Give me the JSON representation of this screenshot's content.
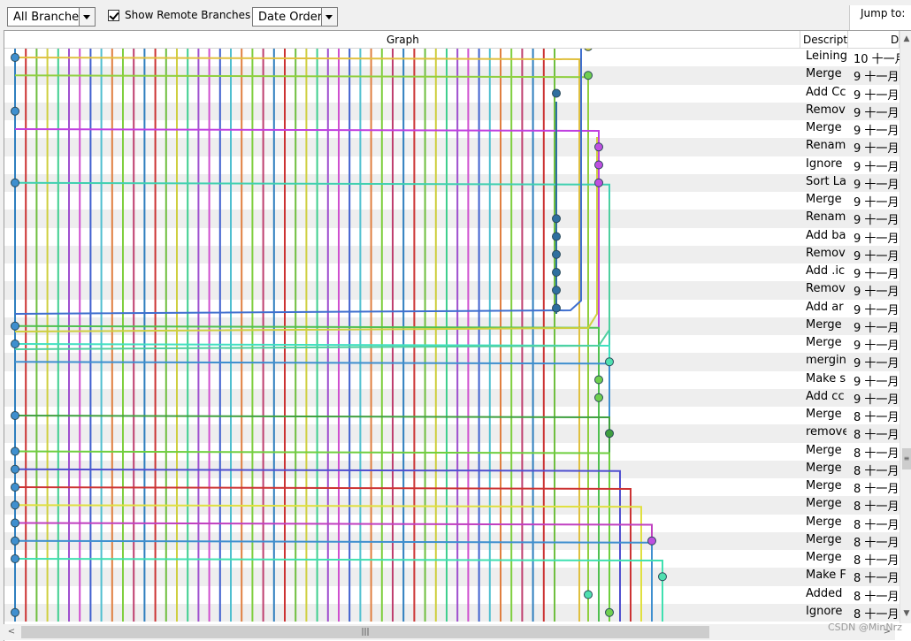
{
  "toolbar": {
    "branch_select": "All Branches",
    "show_remote_label": "Show Remote Branches",
    "show_remote_checked": true,
    "order_select": "Date Order",
    "jump_label": "Jump to:"
  },
  "columns": {
    "graph": "Graph",
    "description": "Descript",
    "date": "D"
  },
  "rows": [
    {
      "desc": "Leining",
      "date": "10 十一月"
    },
    {
      "desc": "Merge",
      "date": "9 十一月"
    },
    {
      "desc": "Add Cc",
      "date": "9 十一月"
    },
    {
      "desc": "Remov",
      "date": "9 十一月"
    },
    {
      "desc": "Merge",
      "date": "9 十一月"
    },
    {
      "desc": "Renam",
      "date": "9 十一月"
    },
    {
      "desc": "Ignore",
      "date": "9 十一月"
    },
    {
      "desc": "Sort La",
      "date": "9 十一月"
    },
    {
      "desc": "Merge",
      "date": "9 十一月"
    },
    {
      "desc": "Renam",
      "date": "9 十一月"
    },
    {
      "desc": "Add ba",
      "date": "9 十一月"
    },
    {
      "desc": "Remov",
      "date": "9 十一月"
    },
    {
      "desc": "Add .ic",
      "date": "9 十一月"
    },
    {
      "desc": "Remov",
      "date": "9 十一月"
    },
    {
      "desc": "Add ar",
      "date": "9 十一月"
    },
    {
      "desc": "Merge",
      "date": "9 十一月"
    },
    {
      "desc": "Merge",
      "date": "9 十一月"
    },
    {
      "desc": "mergin",
      "date": "9 十一月"
    },
    {
      "desc": "Make s",
      "date": "9 十一月"
    },
    {
      "desc": "Add cc",
      "date": "9 十一月"
    },
    {
      "desc": "Merge",
      "date": "8 十一月"
    },
    {
      "desc": "remove",
      "date": "8 十一月"
    },
    {
      "desc": "Merge",
      "date": "8 十一月"
    },
    {
      "desc": "Merge",
      "date": "8 十一月"
    },
    {
      "desc": "Merge",
      "date": "8 十一月"
    },
    {
      "desc": "Merge",
      "date": "8 十一月"
    },
    {
      "desc": "Merge",
      "date": "8 十一月"
    },
    {
      "desc": "Merge",
      "date": "8 十一月"
    },
    {
      "desc": "Merge",
      "date": "8 十一月"
    },
    {
      "desc": "Make F",
      "date": "8 十一月"
    },
    {
      "desc": "Added",
      "date": "8 十一月"
    },
    {
      "desc": "Ignore",
      "date": "8 十一月"
    }
  ],
  "graph": {
    "lane_colors": [
      "#2f7fbf",
      "#cc3333",
      "#6fbf3f",
      "#cfcf3f",
      "#3fcf8f",
      "#9f4fcf",
      "#cf4fcf",
      "#3f5fcf",
      "#4fbfcf",
      "#e07f3f",
      "#7fcf3f",
      "#bf3f6f"
    ],
    "node_fill": {
      "blue": "#3f8fcf",
      "green": "#6fcf4f",
      "purple": "#bf4fe0",
      "cyan": "#4fe0b0",
      "yellow": "#d8cf3f"
    }
  },
  "watermark": "CSDN @MinNrz"
}
